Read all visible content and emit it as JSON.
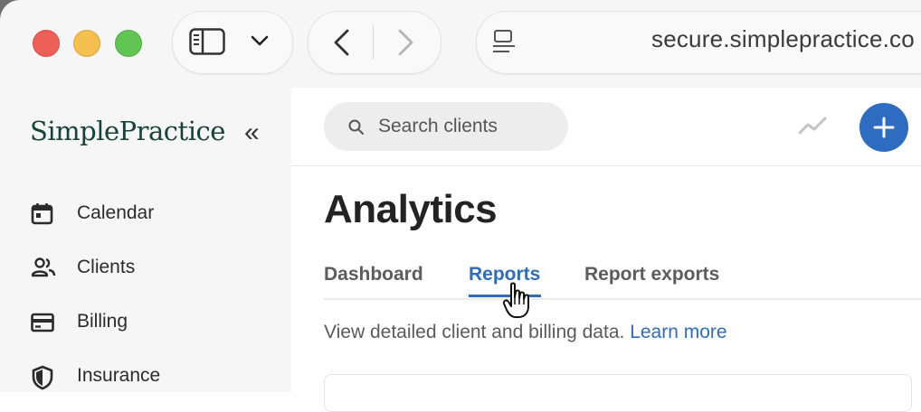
{
  "browser": {
    "url": "secure.simplepractice.co"
  },
  "app": {
    "logo_text": "SimplePractice",
    "collapse_glyph": "«",
    "nav": [
      {
        "label": "Calendar",
        "icon": "calendar-icon"
      },
      {
        "label": "Clients",
        "icon": "users-icon"
      },
      {
        "label": "Billing",
        "icon": "credit-card-icon"
      },
      {
        "label": "Insurance",
        "icon": "shield-icon"
      }
    ]
  },
  "topbar": {
    "search_placeholder": "Search clients",
    "add_glyph": "+"
  },
  "page": {
    "title": "Analytics",
    "tabs": [
      {
        "label": "Dashboard",
        "active": false
      },
      {
        "label": "Reports",
        "active": true
      },
      {
        "label": "Report exports",
        "active": false
      }
    ],
    "description": "View detailed client and billing data.",
    "learn_more": "Learn more"
  },
  "colors": {
    "accent": "#2d6cc0",
    "logo": "#17423b"
  }
}
